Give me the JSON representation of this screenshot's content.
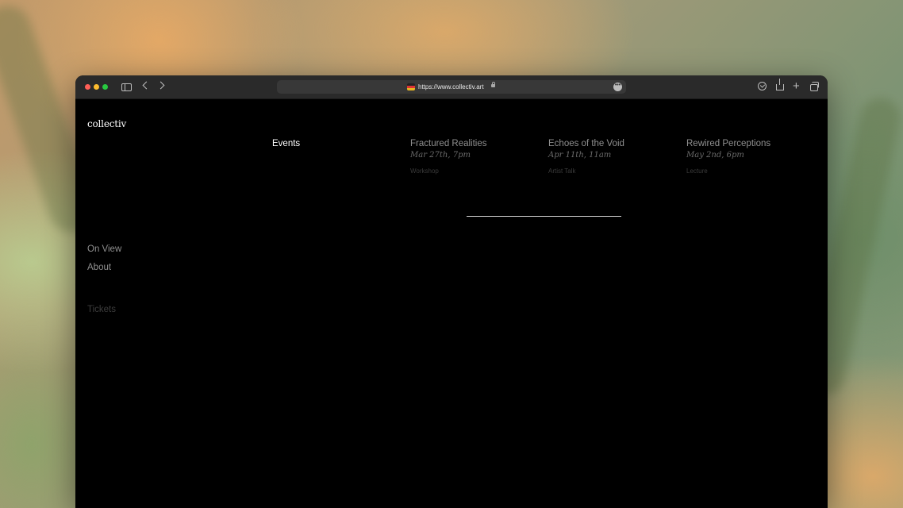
{
  "browser": {
    "url": "https://www.collectiv.art"
  },
  "site": {
    "logo": "collectiv",
    "nav": {
      "on_view": "On View",
      "about": "About",
      "tickets": "Tickets"
    },
    "section_title": "Events",
    "events": [
      {
        "title": "Fractured Realities",
        "date": "Mar 27th, 7pm",
        "type": "Workshop"
      },
      {
        "title": "Echoes of the Void",
        "date": "Apr 11th, 11am",
        "type": "Artist Talk"
      },
      {
        "title": "Rewired Perceptions",
        "date": "May 2nd, 6pm",
        "type": "Lecture"
      }
    ]
  },
  "colors": {
    "page_background": "#000000",
    "text_primary": "#ffffff",
    "text_muted": "#8f8f8f",
    "text_dim": "#3b3b3b"
  }
}
